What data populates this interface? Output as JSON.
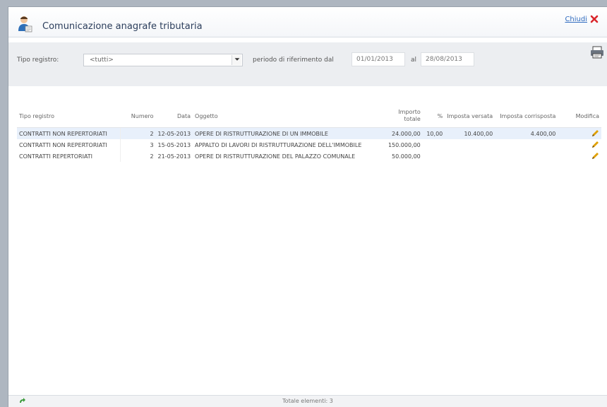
{
  "window": {
    "title": "Comunicazione anagrafe tributaria",
    "close_label": "Chiudi"
  },
  "filters": {
    "registro_label": "Tipo registro:",
    "registro_value": "<tutti>",
    "periodo_label": "periodo di riferimento dal",
    "date_from": "01/01/2013",
    "al_label": "al",
    "date_to": "28/08/2013"
  },
  "table": {
    "columns": {
      "tipo": "Tipo registro",
      "numero": "Numero",
      "data": "Data",
      "oggetto": "Oggetto",
      "importo": "Importo totale",
      "perc": "%",
      "imposta_versata": "Imposta versata",
      "imposta_corrisposta": "Imposta corrisposta",
      "modifica": "Modifica"
    },
    "rows": [
      {
        "tipo": "CONTRATTI NON REPERTORIATI",
        "numero": "2",
        "data": "12-05-2013",
        "oggetto": "OPERE DI RISTRUTTURAZIONE DI UN IMMOBILE",
        "importo": "24.000,00",
        "perc": "10,00",
        "imposta_versata": "10.400,00",
        "imposta_corrisposta": "4.400,00"
      },
      {
        "tipo": "CONTRATTI NON REPERTORIATI",
        "numero": "3",
        "data": "15-05-2013",
        "oggetto": "APPALTO DI LAVORI DI RISTRUTTURAZIONE DELL'IMMOBILE",
        "importo": "150.000,00",
        "perc": "",
        "imposta_versata": "",
        "imposta_corrisposta": ""
      },
      {
        "tipo": "CONTRATTI REPERTORIATI",
        "numero": "2",
        "data": "21-05-2013",
        "oggetto": "OPERE DI RISTRUTTURAZIONE DEL PALAZZO COMUNALE",
        "importo": "50.000,00",
        "perc": "",
        "imposta_versata": "",
        "imposta_corrisposta": ""
      }
    ]
  },
  "status": {
    "total_label": "Totale elementi: 3"
  },
  "colors": {
    "accent": "#2f6bbf",
    "selected_row": "#e8f0fb",
    "close_red": "#d9262c",
    "pencil": "#e0a000"
  }
}
